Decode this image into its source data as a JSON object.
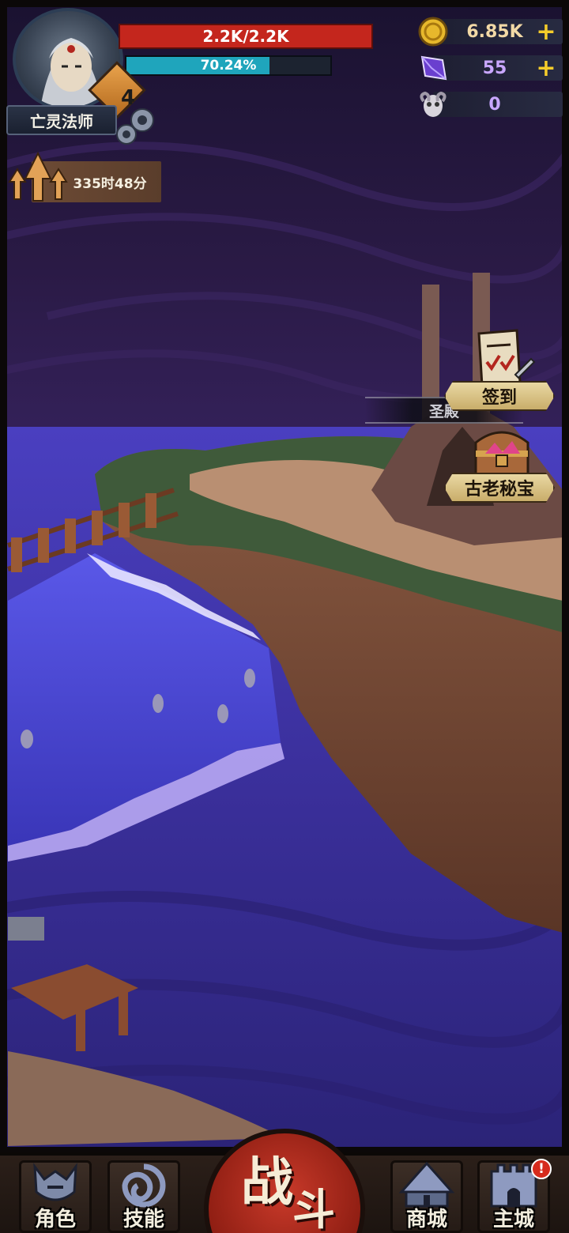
{
  "player": {
    "class_name": "亡灵法师",
    "level": "4",
    "hp_text": "2.2K/2.2K",
    "exp_text": "70.24%",
    "exp_fraction": 0.7024
  },
  "currencies": [
    {
      "icon": "gold-coin-icon",
      "value": "6.85K",
      "color": "#f2d9a6",
      "has_plus": true
    },
    {
      "icon": "purple-crystal-icon",
      "value": "55",
      "color": "#c9a7ff",
      "has_plus": true
    },
    {
      "icon": "ram-skull-icon",
      "value": "0",
      "color": "#c9a7ff",
      "has_plus": false
    }
  ],
  "plus_symbol": "+",
  "timer": {
    "text": "335时48分",
    "icon": "rank-up-arrows-icon"
  },
  "map": {
    "place_label": "圣殿",
    "events": [
      {
        "id": "checkin",
        "label": "签到",
        "icon": "checklist-scroll-icon"
      },
      {
        "id": "treasure",
        "label": "古老秘宝",
        "icon": "treasure-chest-icon"
      }
    ]
  },
  "nav": {
    "items": [
      {
        "id": "character",
        "label": "角色",
        "icon": "helmet-icon"
      },
      {
        "id": "skills",
        "label": "技能",
        "icon": "swirl-icon"
      },
      {
        "id": "shop",
        "label": "商城",
        "icon": "tent-icon",
        "alert": ""
      },
      {
        "id": "main_city",
        "label": "主城",
        "icon": "castle-icon",
        "alert": "!"
      }
    ],
    "battle": {
      "char1": "战",
      "char2": "斗"
    }
  },
  "colors": {
    "hp": "#c4261d",
    "exp": "#1fa5bc",
    "accent_gold": "#f5cc2a",
    "sky": "#2a1a45",
    "sea": "#3a2f9a"
  }
}
